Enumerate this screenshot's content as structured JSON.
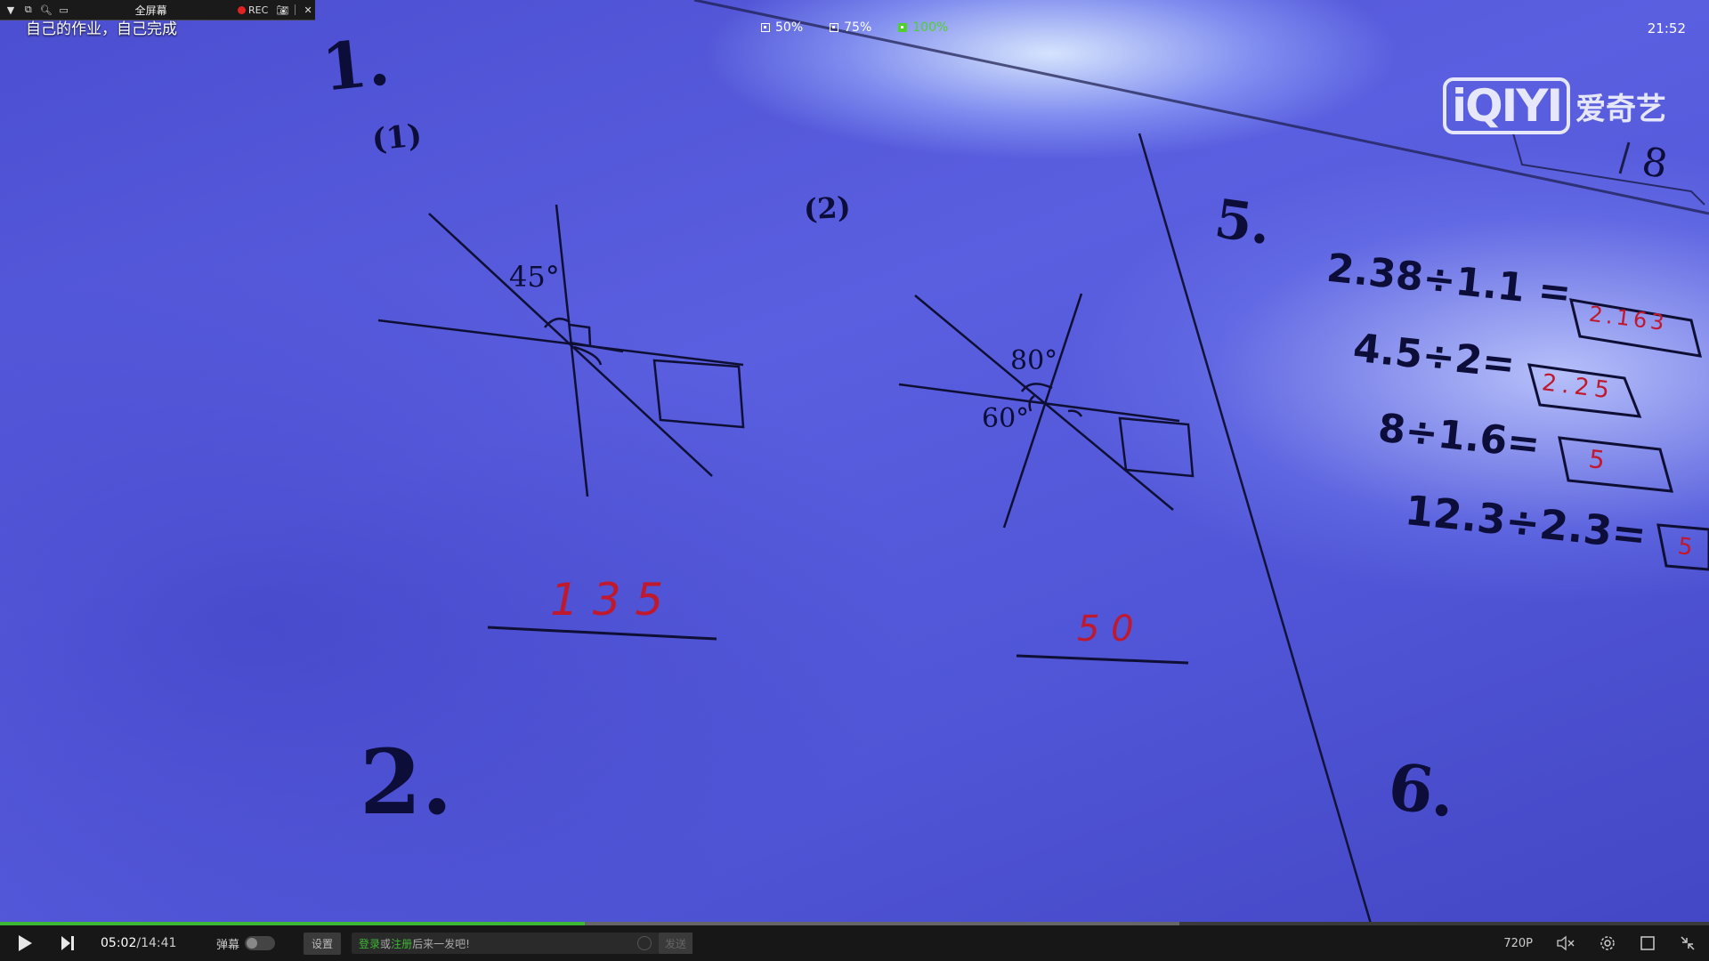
{
  "recorder_bar": {
    "fullscreen_label": "全屏幕",
    "rec_label": "REC"
  },
  "video": {
    "title": "自己的作业，自己完成",
    "quality_options": [
      "50%",
      "75%",
      "100%"
    ],
    "clock": "21:52",
    "logo_mark": "iQIYI",
    "logo_text": "爱奇艺",
    "worksheet": {
      "section1": "1.",
      "part1": "(1)",
      "part2": "(2)",
      "angle_45": "45°",
      "angle_80": "80°",
      "angle_60": "60°",
      "answer1": "1 3 5",
      "answer2": "5 0",
      "section2": "2.",
      "section5": "5.",
      "section6": "6.",
      "page_mark": "8",
      "equations": [
        {
          "expr": "2.38÷1.1 =",
          "answer": "2.163"
        },
        {
          "expr": "4.5÷2=",
          "answer": "2.25"
        },
        {
          "expr": "8÷1.6=",
          "answer": "5"
        },
        {
          "expr": "12.3÷2.3=",
          "answer": "5"
        }
      ]
    }
  },
  "player": {
    "current_time": "05:02",
    "total_time": "/14:41",
    "progress_played": 0.342,
    "progress_buffered": 0.69,
    "danmaku_label": "弹幕",
    "settings_label": "设置",
    "login_text": "登录",
    "or_text": "或",
    "register_text": "注册",
    "prompt_text": "后来一发吧!",
    "send_label": "发送",
    "resolution": "720P",
    "accent_color": "#3db835"
  }
}
